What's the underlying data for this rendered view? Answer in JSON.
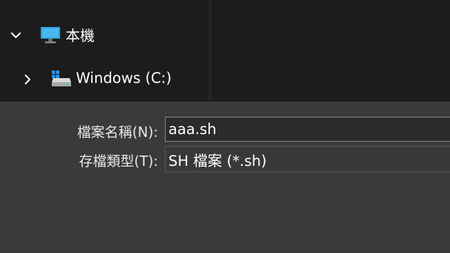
{
  "navigation": {
    "items": [
      {
        "label": "本機",
        "icon": "computer-icon",
        "expanded": true
      },
      {
        "label": "Windows (C:)",
        "icon": "drive-icon",
        "expanded": false
      }
    ]
  },
  "form": {
    "filename_label": "檔案名稱(N):",
    "filename_value": "aaa.sh",
    "filetype_label": "存檔類型(T):",
    "filetype_value": "SH 檔案 (*.sh)"
  },
  "colors": {
    "nav_background": "#1c1c1c",
    "form_background": "#3a3a3a",
    "text": "#ffffff",
    "monitor_blue": "#2ea2e0"
  }
}
